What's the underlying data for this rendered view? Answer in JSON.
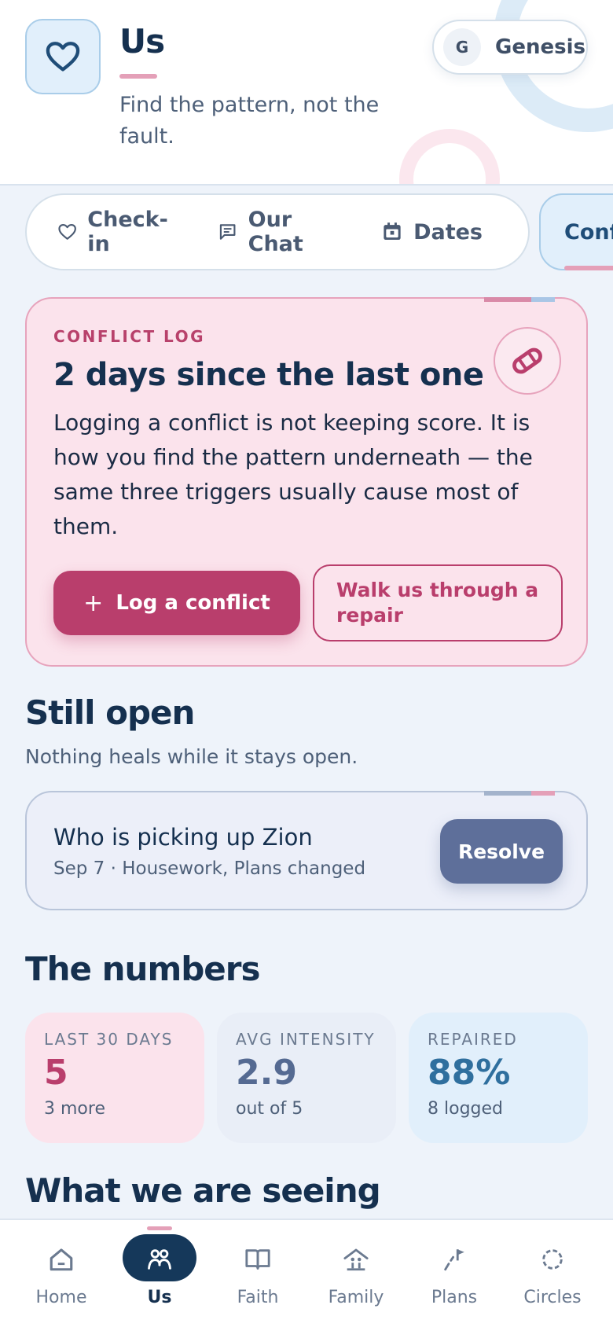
{
  "header": {
    "title": "Us",
    "subtitle": "Find the pattern, not the fault.",
    "user": {
      "initial": "G",
      "name": "Genesis"
    }
  },
  "tabs": [
    {
      "label": "Check-in",
      "icon": "heart-outline-icon"
    },
    {
      "label": "Our Chat",
      "icon": "chat-icon"
    },
    {
      "label": "Dates",
      "icon": "calendar-icon"
    }
  ],
  "active_tab": {
    "label": "Conflicts"
  },
  "conflict_card": {
    "eyebrow": "CONFLICT LOG",
    "title": "2 days since the last one",
    "body": "Logging a conflict is not keeping score. It is how you find the pattern underneath — the same three triggers usually cause most of them.",
    "log_button": "Log a conflict",
    "repair_button": "Walk us through a repair",
    "icon": "bandage-icon"
  },
  "still_open": {
    "title": "Still open",
    "subtitle": "Nothing heals while it stays open.",
    "items": [
      {
        "title": "Who is picking up Zion",
        "meta": "Sep 7 · Housework, Plans changed",
        "action": "Resolve"
      }
    ]
  },
  "numbers": {
    "title": "The numbers",
    "stats": [
      {
        "label": "LAST 30 DAYS",
        "value": "5",
        "note": "3 more",
        "color": "#b93e6c"
      },
      {
        "label": "AVG INTENSITY",
        "value": "2.9",
        "note": "out of 5",
        "color": "#556a92"
      },
      {
        "label": "REPAIRED",
        "value": "88%",
        "note": "8 logged",
        "color": "#2f6f9e"
      }
    ]
  },
  "seeing": {
    "title": "What we are seeing"
  },
  "nav": [
    {
      "label": "Home",
      "icon": "home-icon"
    },
    {
      "label": "Us",
      "icon": "couple-icon",
      "active": true
    },
    {
      "label": "Faith",
      "icon": "book-icon"
    },
    {
      "label": "Family",
      "icon": "family-home-icon"
    },
    {
      "label": "Plans",
      "icon": "flag-path-icon"
    },
    {
      "label": "Circles",
      "icon": "circle-dots-icon"
    }
  ],
  "colors": {
    "accent_pink": "#b93e6c",
    "navy": "#15304f",
    "pink_card": "#fbe3ec",
    "blue_tint": "#e1effb",
    "slate_button": "#5e6f9a"
  }
}
